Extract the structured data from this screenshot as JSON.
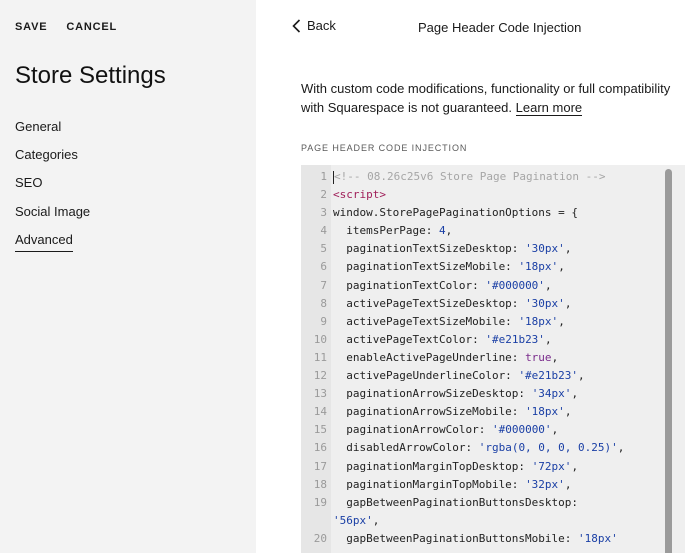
{
  "sidebar": {
    "save_label": "SAVE",
    "cancel_label": "CANCEL",
    "title": "Store Settings",
    "items": [
      {
        "label": "General",
        "active": false
      },
      {
        "label": "Categories",
        "active": false
      },
      {
        "label": "SEO",
        "active": false
      },
      {
        "label": "Social Image",
        "active": false
      },
      {
        "label": "Advanced",
        "active": true
      }
    ]
  },
  "panel": {
    "back_label": "Back",
    "title": "Page Header Code Injection",
    "description": "With custom code modifications, functionality or full compatibility with Squarespace is not guaranteed.",
    "learn_more": "Learn more",
    "section_label": "PAGE HEADER CODE INJECTION"
  },
  "editor": {
    "lines": [
      {
        "num": "1",
        "tokens": [
          {
            "t": "<!-- 08.26c25v6 Store Page Pagination -->",
            "c": "comment"
          }
        ]
      },
      {
        "num": "2",
        "tokens": [
          {
            "t": "<script>",
            "c": "tag"
          }
        ]
      },
      {
        "num": "3",
        "tokens": [
          {
            "t": "window.StorePagePaginationOptions = {",
            "c": "plain"
          }
        ]
      },
      {
        "num": "4",
        "tokens": [
          {
            "t": "  itemsPerPage: ",
            "c": "plain"
          },
          {
            "t": "4",
            "c": "num"
          },
          {
            "t": ",",
            "c": "plain"
          }
        ]
      },
      {
        "num": "5",
        "tokens": [
          {
            "t": "  paginationTextSizeDesktop: ",
            "c": "plain"
          },
          {
            "t": "'30px'",
            "c": "str"
          },
          {
            "t": ",",
            "c": "plain"
          }
        ]
      },
      {
        "num": "6",
        "tokens": [
          {
            "t": "  paginationTextSizeMobile: ",
            "c": "plain"
          },
          {
            "t": "'18px'",
            "c": "str"
          },
          {
            "t": ",",
            "c": "plain"
          }
        ]
      },
      {
        "num": "7",
        "tokens": [
          {
            "t": "  paginationTextColor: ",
            "c": "plain"
          },
          {
            "t": "'#000000'",
            "c": "str"
          },
          {
            "t": ",",
            "c": "plain"
          }
        ]
      },
      {
        "num": "8",
        "tokens": [
          {
            "t": "  activePageTextSizeDesktop: ",
            "c": "plain"
          },
          {
            "t": "'30px'",
            "c": "str"
          },
          {
            "t": ",",
            "c": "plain"
          }
        ]
      },
      {
        "num": "9",
        "tokens": [
          {
            "t": "  activePageTextSizeMobile: ",
            "c": "plain"
          },
          {
            "t": "'18px'",
            "c": "str"
          },
          {
            "t": ",",
            "c": "plain"
          }
        ]
      },
      {
        "num": "10",
        "tokens": [
          {
            "t": "  activePageTextColor: ",
            "c": "plain"
          },
          {
            "t": "'#e21b23'",
            "c": "str"
          },
          {
            "t": ",",
            "c": "plain"
          }
        ]
      },
      {
        "num": "11",
        "tokens": [
          {
            "t": "  enableActivePageUnderline: ",
            "c": "plain"
          },
          {
            "t": "true",
            "c": "kw"
          },
          {
            "t": ",",
            "c": "plain"
          }
        ]
      },
      {
        "num": "12",
        "tokens": [
          {
            "t": "  activePageUnderlineColor: ",
            "c": "plain"
          },
          {
            "t": "'#e21b23'",
            "c": "str"
          },
          {
            "t": ",",
            "c": "plain"
          }
        ]
      },
      {
        "num": "13",
        "tokens": [
          {
            "t": "  paginationArrowSizeDesktop: ",
            "c": "plain"
          },
          {
            "t": "'34px'",
            "c": "str"
          },
          {
            "t": ",",
            "c": "plain"
          }
        ]
      },
      {
        "num": "14",
        "tokens": [
          {
            "t": "  paginationArrowSizeMobile: ",
            "c": "plain"
          },
          {
            "t": "'18px'",
            "c": "str"
          },
          {
            "t": ",",
            "c": "plain"
          }
        ]
      },
      {
        "num": "15",
        "tokens": [
          {
            "t": "  paginationArrowColor: ",
            "c": "plain"
          },
          {
            "t": "'#000000'",
            "c": "str"
          },
          {
            "t": ",",
            "c": "plain"
          }
        ]
      },
      {
        "num": "16",
        "tokens": [
          {
            "t": "  disabledArrowColor: ",
            "c": "plain"
          },
          {
            "t": "'rgba(0, 0, 0, 0.25)'",
            "c": "str"
          },
          {
            "t": ",",
            "c": "plain"
          }
        ]
      },
      {
        "num": "17",
        "tokens": [
          {
            "t": "  paginationMarginTopDesktop: ",
            "c": "plain"
          },
          {
            "t": "'72px'",
            "c": "str"
          },
          {
            "t": ",",
            "c": "plain"
          }
        ]
      },
      {
        "num": "18",
        "tokens": [
          {
            "t": "  paginationMarginTopMobile: ",
            "c": "plain"
          },
          {
            "t": "'32px'",
            "c": "str"
          },
          {
            "t": ",",
            "c": "plain"
          }
        ]
      },
      {
        "num": "19",
        "tokens": [
          {
            "t": "  gapBetweenPaginationButtonsDesktop:",
            "c": "plain"
          }
        ]
      },
      {
        "num": "",
        "tokens": [
          {
            "t": "'56px'",
            "c": "str"
          },
          {
            "t": ",",
            "c": "plain"
          }
        ]
      },
      {
        "num": "20",
        "tokens": [
          {
            "t": "  gapBetweenPaginationButtonsMobile: ",
            "c": "plain"
          },
          {
            "t": "'18px'",
            "c": "str"
          }
        ]
      }
    ]
  }
}
